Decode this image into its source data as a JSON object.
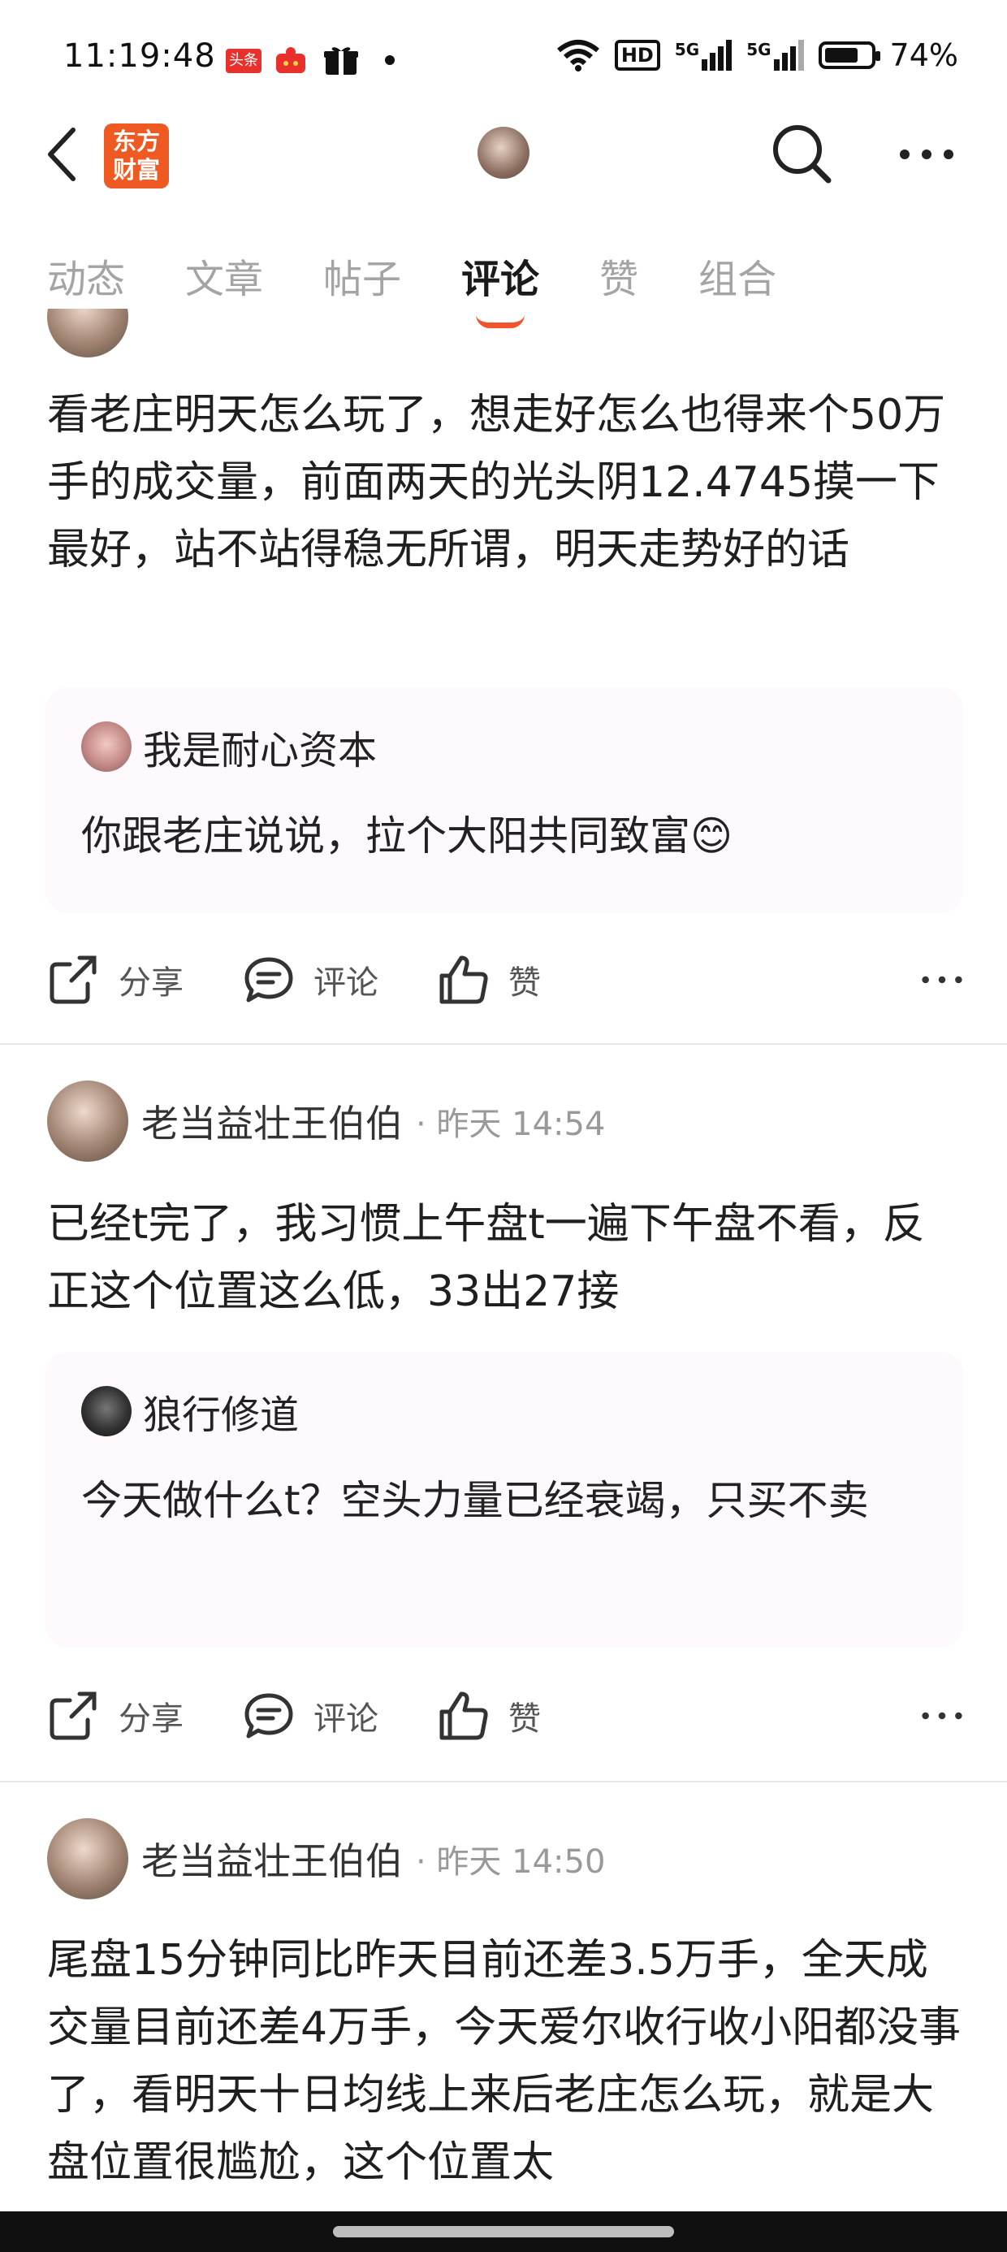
{
  "status_bar": {
    "time": "11:19:48",
    "badge_text": "头条",
    "battery": "74%",
    "battery_level": 0.74,
    "net1": "HD",
    "net2": "5G",
    "net3": "5G"
  },
  "nav": {
    "logo_line1": "东方",
    "logo_line2": "财富"
  },
  "tabs": [
    {
      "label": "动态"
    },
    {
      "label": "文章"
    },
    {
      "label": "帖子"
    },
    {
      "label": "评论",
      "active": true
    },
    {
      "label": "赞"
    },
    {
      "label": "组合"
    }
  ],
  "posts": [
    {
      "text": "看老庄明天怎么玩了，想走好怎么也得来个50万手的成交量，前面两天的光头阴12.4745摸一下最好，站不站得稳无所谓，明天走势好的话",
      "quote": {
        "author": "我是耐心资本",
        "text": "你跟老庄说说，拉个大阳共同致富😊"
      }
    },
    {
      "author": "老当益壮王伯伯",
      "time": "· 昨天 14:54",
      "text": "已经t完了，我习惯上午盘t一遍下午盘不看，反正这个位置这么低，33出27接",
      "quote": {
        "author": "狼行修道",
        "text": "今天做什么t？空头力量已经衰竭，只买不卖"
      }
    },
    {
      "author": "老当益壮王伯伯",
      "time": "· 昨天 14:50",
      "text": "尾盘15分钟同比昨天目前还差3.5万手，全天成交量目前还差4万手，今天爱尔收行收小阳都没事了，看明天十日均线上来后老庄怎么玩，就是大盘位置很尴尬，这个位置太"
    }
  ],
  "actions": {
    "share": "分享",
    "comment": "评论",
    "like": "赞"
  },
  "colors": {
    "accent": "#f2552c",
    "logo_bg": "#ef5a22",
    "quote_bg": "#fdf9fc"
  }
}
